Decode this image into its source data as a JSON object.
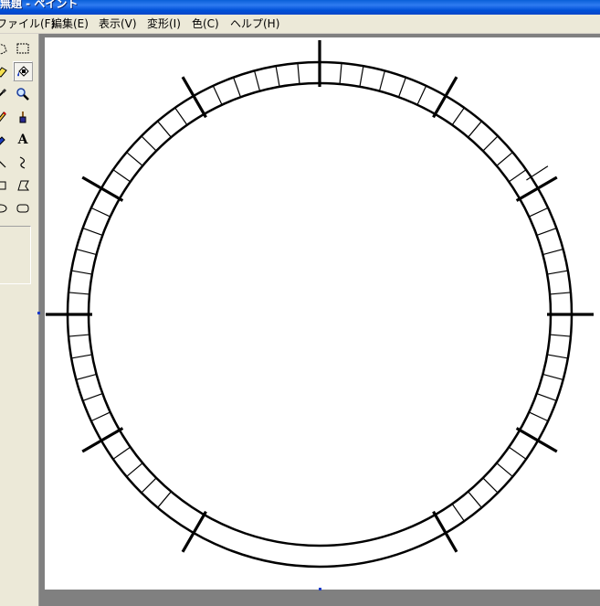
{
  "window": {
    "title": "無題 - ペイント"
  },
  "menu": [
    {
      "id": "file",
      "label": "ファイル(F)"
    },
    {
      "id": "edit",
      "label": "編集(E)"
    },
    {
      "id": "view",
      "label": "表示(V)"
    },
    {
      "id": "image",
      "label": "変形(I)"
    },
    {
      "id": "colors",
      "label": "色(C)"
    },
    {
      "id": "help",
      "label": "ヘルプ(H)"
    }
  ],
  "toolbox": {
    "tools": [
      {
        "name": "free-form-select",
        "icon": "free-select-icon"
      },
      {
        "name": "select",
        "icon": "rect-select-icon"
      },
      {
        "name": "eraser",
        "icon": "eraser-icon"
      },
      {
        "name": "fill",
        "icon": "fill-bucket-icon",
        "selected": true
      },
      {
        "name": "pick-color",
        "icon": "eyedropper-icon"
      },
      {
        "name": "magnifier",
        "icon": "magnifier-icon"
      },
      {
        "name": "pencil",
        "icon": "pencil-icon"
      },
      {
        "name": "brush",
        "icon": "brush-icon"
      },
      {
        "name": "airbrush",
        "icon": "airbrush-icon"
      },
      {
        "name": "text",
        "icon": "text-icon",
        "glyph": "A"
      },
      {
        "name": "line",
        "icon": "line-icon"
      },
      {
        "name": "curve",
        "icon": "curve-icon"
      },
      {
        "name": "rectangle",
        "icon": "rectangle-icon"
      },
      {
        "name": "polygon",
        "icon": "polygon-icon"
      },
      {
        "name": "ellipse",
        "icon": "ellipse-icon"
      },
      {
        "name": "rounded-rectangle",
        "icon": "rounded-rect-icon"
      }
    ]
  },
  "drawing": {
    "stroke_color": "#000000",
    "background_color": "#ffffff",
    "ring_segments": 72,
    "gap_segments": 14,
    "major_ticks": 12,
    "selection_color": "#1c3cc8"
  }
}
